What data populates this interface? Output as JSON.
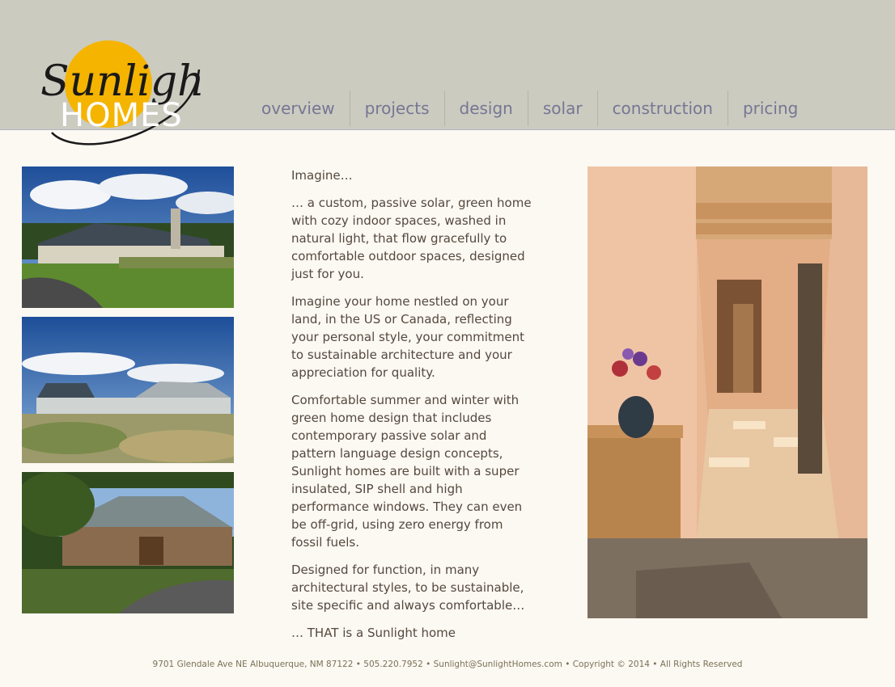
{
  "brand": {
    "logo_word_1": "Sunlight",
    "logo_word_2": "HOMES",
    "sun_color": "#f5b400"
  },
  "nav": {
    "items": [
      {
        "label": "overview"
      },
      {
        "label": "projects"
      },
      {
        "label": "design"
      },
      {
        "label": "solar"
      },
      {
        "label": "construction"
      },
      {
        "label": "pricing"
      }
    ]
  },
  "content": {
    "paragraphs": [
      "Imagine…",
      "… a custom, passive solar, green home with cozy indoor spaces, washed in natural light, that flow gracefully to comfortable outdoor spaces, designed just for you.",
      "Imagine your home nestled on your land, in the US or Canada, reflecting your personal style, your commitment to sustainable architecture and your appreciation for quality.",
      "Comfortable summer and winter with green home design that includes contemporary passive solar and pattern language design concepts, Sunlight homes are built with a super insulated, SIP shell and high performance windows. They can even be off-grid, using zero energy from fossil fuels.",
      "Designed for function, in many architectural styles, to be sustainable, site specific and always comfortable…",
      "… THAT is a Sunlight home"
    ]
  },
  "footer": {
    "text": "9701 Glendale Ave NE Albuquerque, NM 87122 • 505.220.7952 • Sunlight@SunlightHomes.com • Copyright © 2014 • All Rights Reserved"
  },
  "colors": {
    "header_bg": "#cbcbc0",
    "page_bg": "#fcf8f2",
    "nav_text": "#767694",
    "body_text": "#54493e"
  }
}
